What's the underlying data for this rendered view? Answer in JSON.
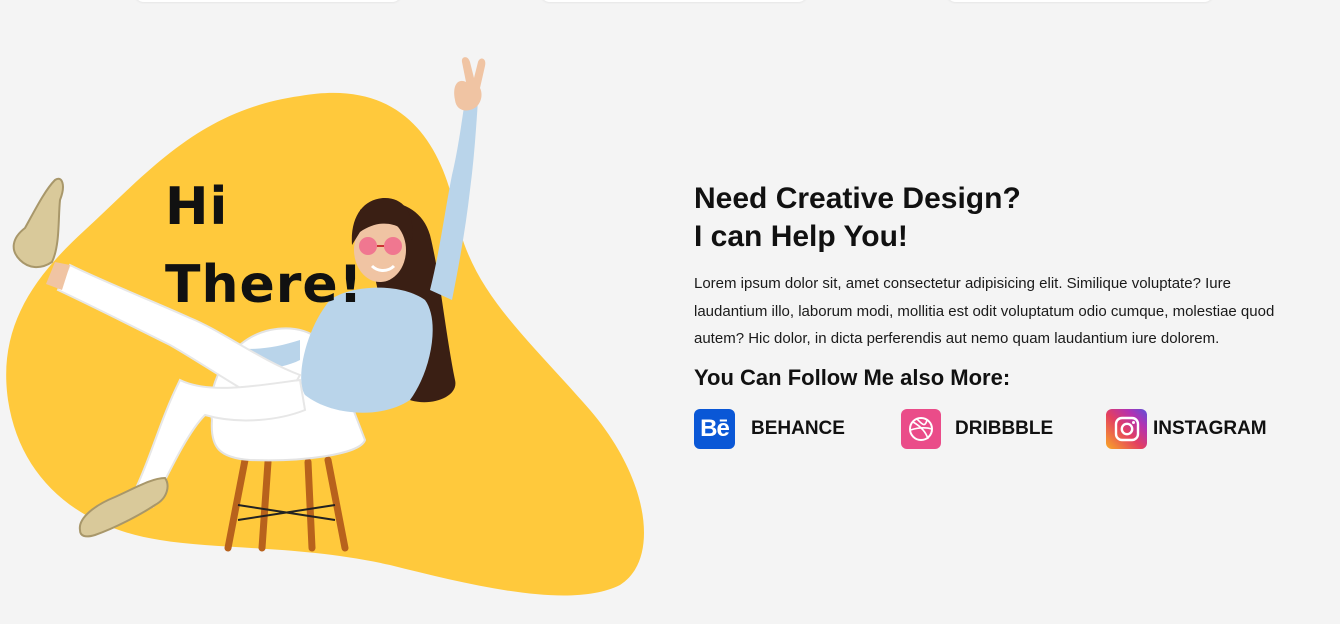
{
  "hero": {
    "greeting_line1": "Hi",
    "greeting_line2": "There!"
  },
  "intro": {
    "headline_line1": "Need Creative Design?",
    "headline_line2": "I can Help You!",
    "description": "Lorem ipsum dolor sit, amet consectetur adipisicing elit. Similique voluptate? Iure laudantium illo, laborum modi, mollitia est odit voluptatum odio cumque, molestiae quod autem? Hic dolor, in dicta perferendis aut nemo quam laudantium iure dolorem.",
    "follow_title": "You Can Follow Me also More:"
  },
  "socials": [
    {
      "label": "BEHANCE",
      "icon": "behance-icon",
      "icon_text": "Bē",
      "color": "#0a57d6"
    },
    {
      "label": "DRIBBBLE",
      "icon": "dribbble-icon",
      "color": "#ea4c89"
    },
    {
      "label": "INSTAGRAM",
      "icon": "instagram-icon",
      "color": "#e4405f"
    }
  ],
  "colors": {
    "background": "#f4f4f4",
    "blob": "#ffc93c"
  }
}
